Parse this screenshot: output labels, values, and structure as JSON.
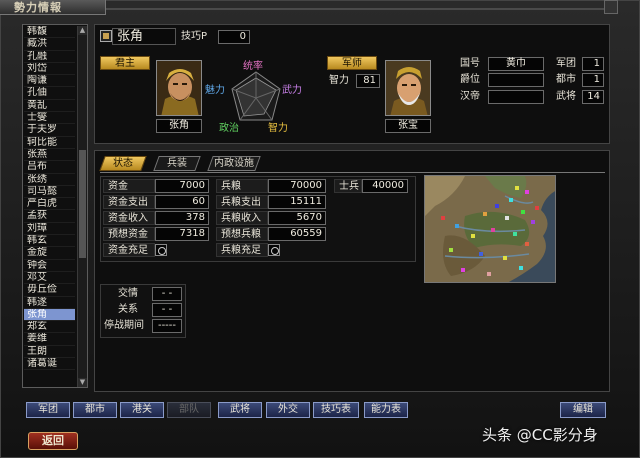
{
  "window": {
    "title": "勢力情報"
  },
  "sidebar": {
    "items": [
      "韩馥",
      "臧洪",
      "孔融",
      "刘岱",
      "陶谦",
      "孔伷",
      "黄乱",
      "士燮",
      "于夫罗",
      "轲比能",
      "张燕",
      "吕布",
      "张绣",
      "司马懿",
      "严白虎",
      "孟获",
      "刘璋",
      "韩玄",
      "金旋",
      "钟会",
      "邓艾",
      "毋丘俭",
      "韩遂",
      "张角",
      "郑玄",
      "姜维",
      "王朗",
      "诸葛诞"
    ],
    "selected_index": 23
  },
  "header": {
    "ruler_name": "张角",
    "skill_label": "技巧P",
    "skill_value": "0",
    "lord_tag": "君主",
    "lord_name": "张角",
    "stat_labels": {
      "lead": "统率",
      "charm": "魅力",
      "war": "武力",
      "politics": "政治",
      "intel": "智力"
    },
    "advisor_tag": "军师",
    "intel_label": "智力",
    "intel_value": "81",
    "advisor_name": "张宝",
    "country_label": "国号",
    "country_value": "黄巾",
    "rank_label": "爵位",
    "rank_value": "",
    "emperor_label": "汉帝",
    "emperor_value": "",
    "corps_label": "军团",
    "corps_value": "1",
    "city_label": "都市",
    "city_value": "1",
    "officer_label": "武将",
    "officer_value": "14"
  },
  "tabs": [
    {
      "label": "状态",
      "active": true
    },
    {
      "label": "兵装",
      "active": false
    },
    {
      "label": "内政设施",
      "active": false
    }
  ],
  "stats": {
    "funds": {
      "label": "资金",
      "value": "7000"
    },
    "funds_expense": {
      "label": "资金支出",
      "value": "60"
    },
    "funds_income": {
      "label": "资金收入",
      "value": "378"
    },
    "funds_forecast": {
      "label": "预想资金",
      "value": "7318"
    },
    "funds_enough": {
      "label": "资金充足"
    },
    "food": {
      "label": "兵粮",
      "value": "70000"
    },
    "food_expense": {
      "label": "兵粮支出",
      "value": "15111"
    },
    "food_income": {
      "label": "兵粮收入",
      "value": "5670"
    },
    "food_forecast": {
      "label": "预想兵粮",
      "value": "60559"
    },
    "food_enough": {
      "label": "兵粮充足"
    },
    "soldiers": {
      "label": "士兵",
      "value": "40000"
    }
  },
  "diplomacy": {
    "relation_label": "交情",
    "relation_value": "- -",
    "status_label": "关系",
    "status_value": "- -",
    "truce_label": "停战期间",
    "truce_value": "-----"
  },
  "bottom_buttons": [
    {
      "label": "军团",
      "enabled": true
    },
    {
      "label": "都市",
      "enabled": true
    },
    {
      "label": "港关",
      "enabled": true
    },
    {
      "label": "部队",
      "enabled": false
    },
    {
      "label": "武将",
      "enabled": true
    },
    {
      "label": "外交",
      "enabled": true
    },
    {
      "label": "技巧表",
      "enabled": true
    },
    {
      "label": "能力表",
      "enabled": true
    }
  ],
  "edit_label": "编辑",
  "back_label": "返回",
  "watermark": "头条 @CC影分身",
  "colors": {
    "gold": "#d8a838",
    "selected": "#7d95d0",
    "button": "#2c3868"
  }
}
